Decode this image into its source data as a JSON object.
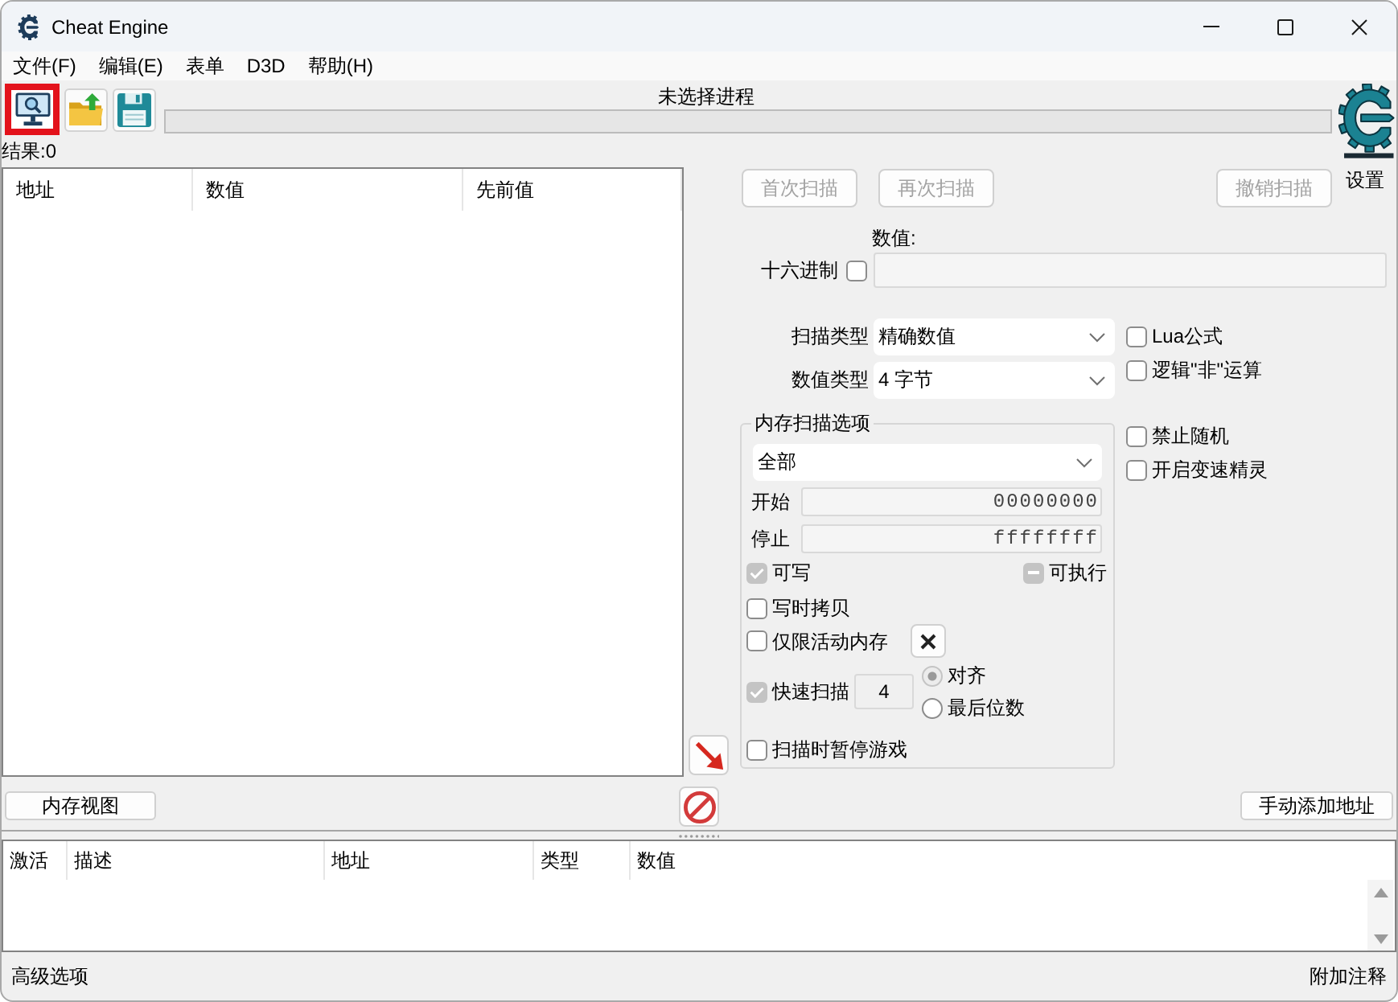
{
  "window": {
    "title": "Cheat Engine"
  },
  "menu": [
    {
      "label": "文件(F)"
    },
    {
      "label": "编辑(E)"
    },
    {
      "label": "表单"
    },
    {
      "label": "D3D"
    },
    {
      "label": "帮助(H)"
    }
  ],
  "toolbar": [
    {
      "kind": "process",
      "highlighted": true
    },
    {
      "kind": "open",
      "highlighted": false
    },
    {
      "kind": "save",
      "highlighted": false
    }
  ],
  "process": {
    "label": "未选择进程"
  },
  "progress": {
    "level": 0
  },
  "settings": {
    "label": "设置"
  },
  "results": "结果:0",
  "found_list": {
    "columns": [
      "地址",
      "数值",
      "先前值"
    ]
  },
  "scan_buttons": [
    {
      "label": "首次扫描",
      "disabled": true
    },
    {
      "label": "再次扫描",
      "disabled": true
    },
    {
      "label": "撤销扫描",
      "disabled": true
    }
  ],
  "value": {
    "label": "数值:",
    "hex": {
      "label": "十六进制",
      "checked": false
    }
  },
  "scan_type": {
    "label": "扫描类型",
    "value": "精确数值"
  },
  "value_type": {
    "label": "数值类型",
    "value": "4 字节"
  },
  "formula_options": [
    {
      "label": "Lua公式",
      "checked": false
    },
    {
      "label": "逻辑\"非\"运算",
      "checked": false
    }
  ],
  "extra_options": [
    {
      "label": "禁止随机",
      "checked": false
    },
    {
      "label": "开启变速精灵",
      "checked": false
    }
  ],
  "memory_scan_options": {
    "title": "内存扫描选项",
    "region": "全部",
    "start": {
      "label": "开始",
      "value": "00000000"
    },
    "stop": {
      "label": "停止",
      "value": "ffffffff"
    },
    "writable": {
      "label": "可写",
      "checked": true
    },
    "executable": {
      "label": "可执行",
      "indeterminate": true
    },
    "copy_on_write": {
      "label": "写时拷贝",
      "checked": false
    },
    "active_memory_only": {
      "label": "仅限活动内存",
      "checked": false
    },
    "fast_scan": {
      "label": "快速扫描",
      "checked": true,
      "value": "4"
    },
    "alignment": [
      {
        "label": "对齐",
        "selected": true
      },
      {
        "label": "最后位数",
        "selected": false
      }
    ],
    "pause_game": {
      "label": "扫描时暂停游戏",
      "checked": false
    }
  },
  "memory_view_button": "内存视图",
  "add_address_button": "手动添加地址",
  "cheat_table": {
    "columns": [
      "激活",
      "描述",
      "地址",
      "类型",
      "数值"
    ]
  },
  "status_bar": {
    "left": "高级选项",
    "right": "附加注释"
  }
}
